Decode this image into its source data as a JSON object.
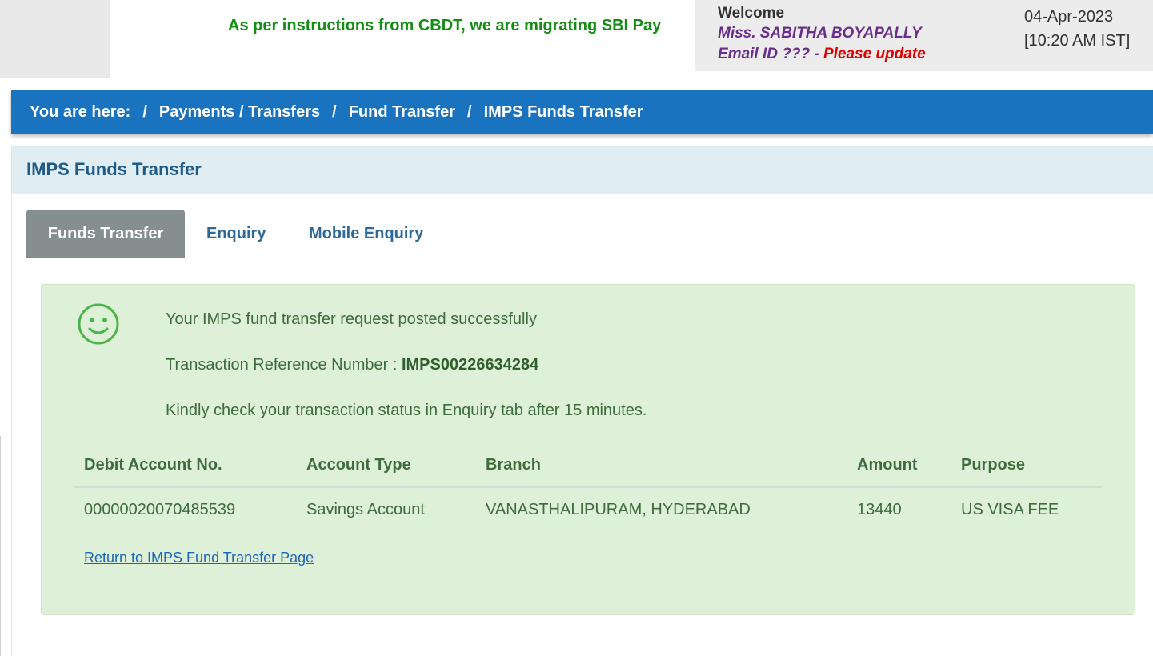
{
  "header": {
    "marquee_text": "As per instructions from CBDT, we are migrating SBI Pay",
    "welcome_label": "Welcome",
    "user_name": "Miss. SABITHA BOYAPALLY",
    "email_label": "Email ID ??? - ",
    "email_update": "Please update",
    "date": "04-Apr-2023",
    "time": "[10:20 AM IST]"
  },
  "breadcrumb": {
    "label": "You are here:",
    "separator": "/",
    "items": [
      "Payments / Transfers",
      "Fund Transfer",
      "IMPS Funds Transfer"
    ]
  },
  "panel": {
    "title": "IMPS Funds Transfer"
  },
  "tabs": [
    {
      "label": "Funds Transfer",
      "active": true
    },
    {
      "label": "Enquiry",
      "active": false
    },
    {
      "label": "Mobile Enquiry",
      "active": false
    }
  ],
  "result": {
    "icon": "smiley-icon",
    "success_message": "Your IMPS fund transfer request posted successfully",
    "ref_label": "Transaction Reference Number : ",
    "ref_number": "IMPS00226634284",
    "note": "Kindly check your transaction status in Enquiry tab after 15 minutes."
  },
  "table": {
    "columns": [
      "Debit Account No.",
      "Account Type",
      "Branch",
      "Amount",
      "Purpose"
    ],
    "rows": [
      [
        "00000020070485539",
        "Savings Account",
        "VANASTHALIPURAM, HYDERABAD",
        "13440",
        "US VISA FEE"
      ]
    ]
  },
  "return_link": "Return to IMPS Fund Transfer Page",
  "colors": {
    "breadcrumb_bg": "#1a73bf",
    "success_bg": "#dff0d8",
    "active_tab_bg": "#858f8f",
    "marquee_green": "#148d14",
    "user_purple": "#6a2e8a",
    "update_red": "#e00000"
  }
}
